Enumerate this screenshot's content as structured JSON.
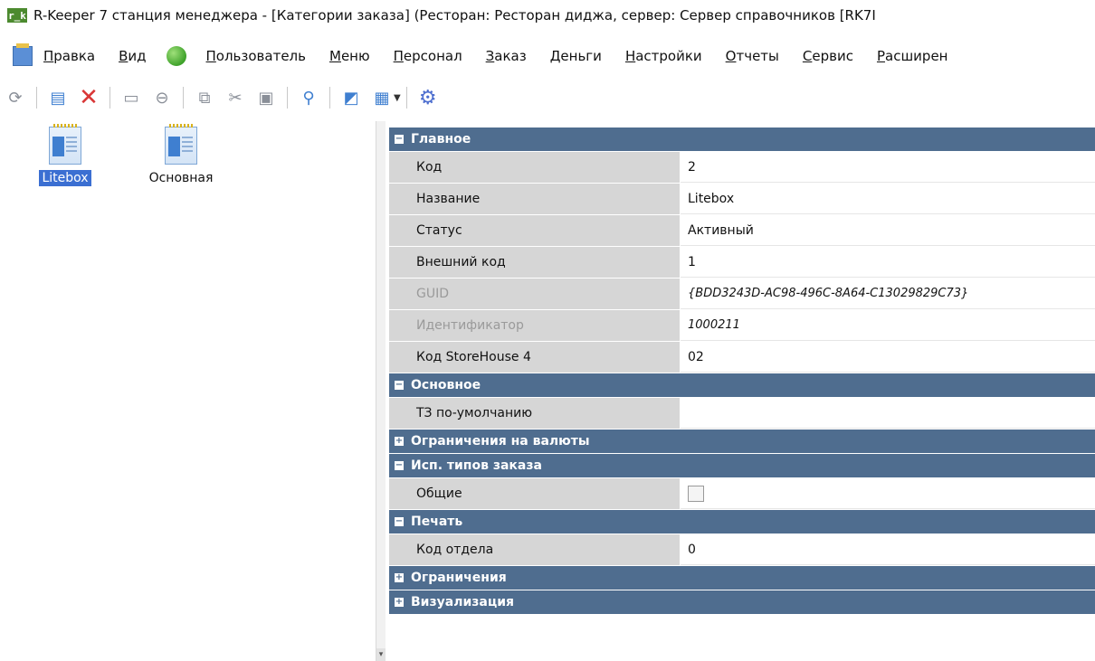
{
  "title": {
    "badge": "r_k",
    "text": "R-Keeper 7 станция менеджера - [Категории заказа] (Ресторан: Ресторан диджа, сервер: Сервер справочников [RK7I"
  },
  "menu": {
    "items": [
      "Правка",
      "Вид",
      "Пользователь",
      "Меню",
      "Персонал",
      "Заказ",
      "Деньги",
      "Настройки",
      "Отчеты",
      "Сервис",
      "Расширен"
    ]
  },
  "toolbar": {
    "icons": [
      "refresh-icon",
      "new-icon",
      "delete-icon",
      "save-icon",
      "cancel-icon",
      "copy-icon",
      "cut-icon",
      "paste-icon",
      "search-icon",
      "image-icon",
      "grid-icon",
      "gear-icon"
    ]
  },
  "categories": [
    {
      "label": "Litebox",
      "selected": true
    },
    {
      "label": "Основная",
      "selected": false
    }
  ],
  "grid": {
    "main": {
      "title": "Главное",
      "rows": [
        {
          "name": "Код",
          "value": "2"
        },
        {
          "name": "Название",
          "value": "Litebox"
        },
        {
          "name": "Статус",
          "value": "Активный"
        },
        {
          "name": "Внешний код",
          "value": "1"
        },
        {
          "name": "GUID",
          "value": "{BDD3243D-AC98-496C-8A64-C13029829C73}"
        },
        {
          "name": "Идентификатор",
          "value": "1000211"
        },
        {
          "name": "Код StoreHouse 4",
          "value": "02"
        }
      ]
    },
    "basic": {
      "title": "Основное",
      "rows": [
        {
          "name": "ТЗ по-умолчанию",
          "value": ""
        }
      ]
    },
    "currency_limits": {
      "title": "Ограничения на валюты"
    },
    "order_types": {
      "title": "Исп. типов заказа",
      "rows": [
        {
          "name": "Общие"
        }
      ]
    },
    "print": {
      "title": "Печать",
      "rows": [
        {
          "name": "Код отдела",
          "value": "0"
        }
      ]
    },
    "limits": {
      "title": "Ограничения"
    },
    "visual": {
      "title": "Визуализация"
    }
  },
  "colors": {
    "section_header": "#4f6d8f",
    "selection": "#3b6fd2",
    "name_column": "#d6d6d6"
  }
}
